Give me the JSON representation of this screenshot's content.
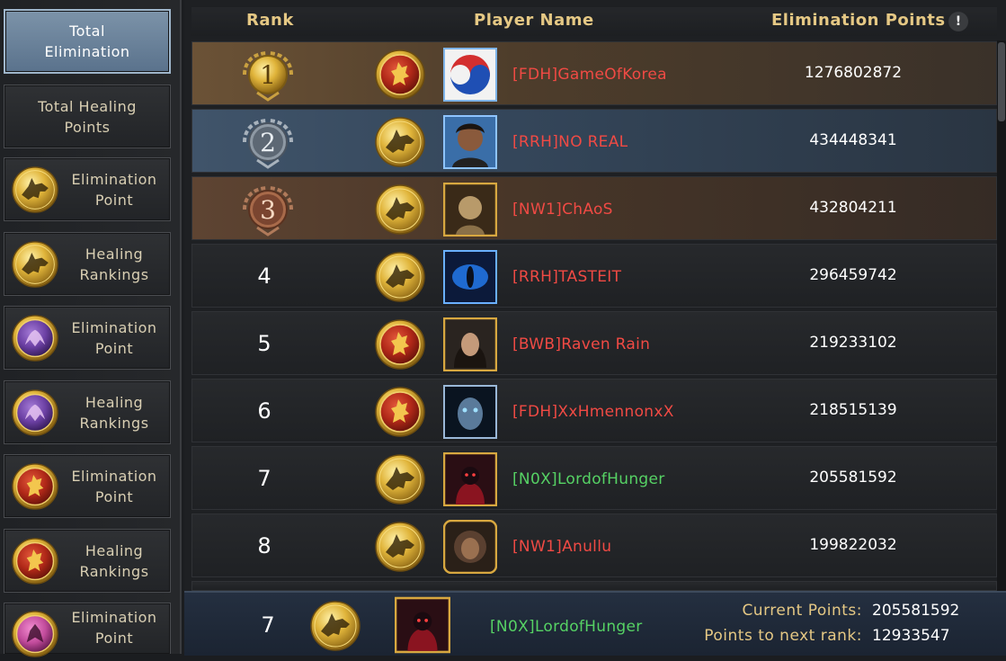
{
  "sidebar": {
    "items": [
      {
        "label_line1": "Total",
        "label_line2": "Elimination",
        "icon": null,
        "active": true
      },
      {
        "label_line1": "Total Healing",
        "label_line2": "Points",
        "icon": null,
        "active": false
      },
      {
        "label_line1": "Elimination",
        "label_line2": "Point",
        "icon": "stark-direwolf-icon",
        "active": false
      },
      {
        "label_line1": "Healing",
        "label_line2": "Rankings",
        "icon": "stark-direwolf-icon",
        "active": false
      },
      {
        "label_line1": "Elimination",
        "label_line2": "Point",
        "icon": "targaryen-dragon-icon",
        "active": false
      },
      {
        "label_line1": "Healing",
        "label_line2": "Rankings",
        "icon": "targaryen-dragon-icon",
        "active": false
      },
      {
        "label_line1": "Elimination",
        "label_line2": "Point",
        "icon": "lannister-lion-icon",
        "active": false
      },
      {
        "label_line1": "Healing",
        "label_line2": "Rankings",
        "icon": "lannister-lion-icon",
        "active": false
      },
      {
        "label_line1": "Elimination",
        "label_line2": "Point",
        "icon": "pink-sigil-icon",
        "active": false
      }
    ]
  },
  "table": {
    "headers": {
      "rank": "Rank",
      "player": "Player Name",
      "points": "Elimination Points"
    },
    "rows": [
      {
        "rank": "1",
        "house": "lannister-lion-icon",
        "name": "[FDH]GameOfKorea",
        "points": "1276802872",
        "name_color": "#f04a44"
      },
      {
        "rank": "2",
        "house": "stark-direwolf-icon",
        "name": "[RRH]NO REAL",
        "points": "434448341",
        "name_color": "#f04a44"
      },
      {
        "rank": "3",
        "house": "stark-direwolf-icon",
        "name": "[NW1]ChAoS",
        "points": "432804211",
        "name_color": "#f04a44"
      },
      {
        "rank": "4",
        "house": "stark-direwolf-icon",
        "name": "[RRH]TASTEIT",
        "points": "296459742",
        "name_color": "#f04a44"
      },
      {
        "rank": "5",
        "house": "lannister-lion-icon",
        "name": "[BWB]Raven Rain",
        "points": "219233102",
        "name_color": "#f04a44"
      },
      {
        "rank": "6",
        "house": "lannister-lion-icon",
        "name": "[FDH]XxHmennonxX",
        "points": "218515139",
        "name_color": "#f04a44"
      },
      {
        "rank": "7",
        "house": "stark-direwolf-icon",
        "name": "[N0X]LordofHunger",
        "points": "205581592",
        "name_color": "#56d264"
      },
      {
        "rank": "8",
        "house": "stark-direwolf-icon",
        "name": "[NW1]Anullu",
        "points": "199822032",
        "name_color": "#f04a44"
      }
    ]
  },
  "footer": {
    "rank": "7",
    "house": "stark-direwolf-icon",
    "name": "[N0X]LordofHunger",
    "current_label": "Current Points:",
    "current_value": "205581592",
    "next_label": "Points to next rank:",
    "next_value": "12933547"
  },
  "colors": {
    "gold_text": "#e5c884",
    "enemy_name": "#f04a44",
    "ally_name": "#56d264",
    "active_tab": "#6a839c"
  }
}
